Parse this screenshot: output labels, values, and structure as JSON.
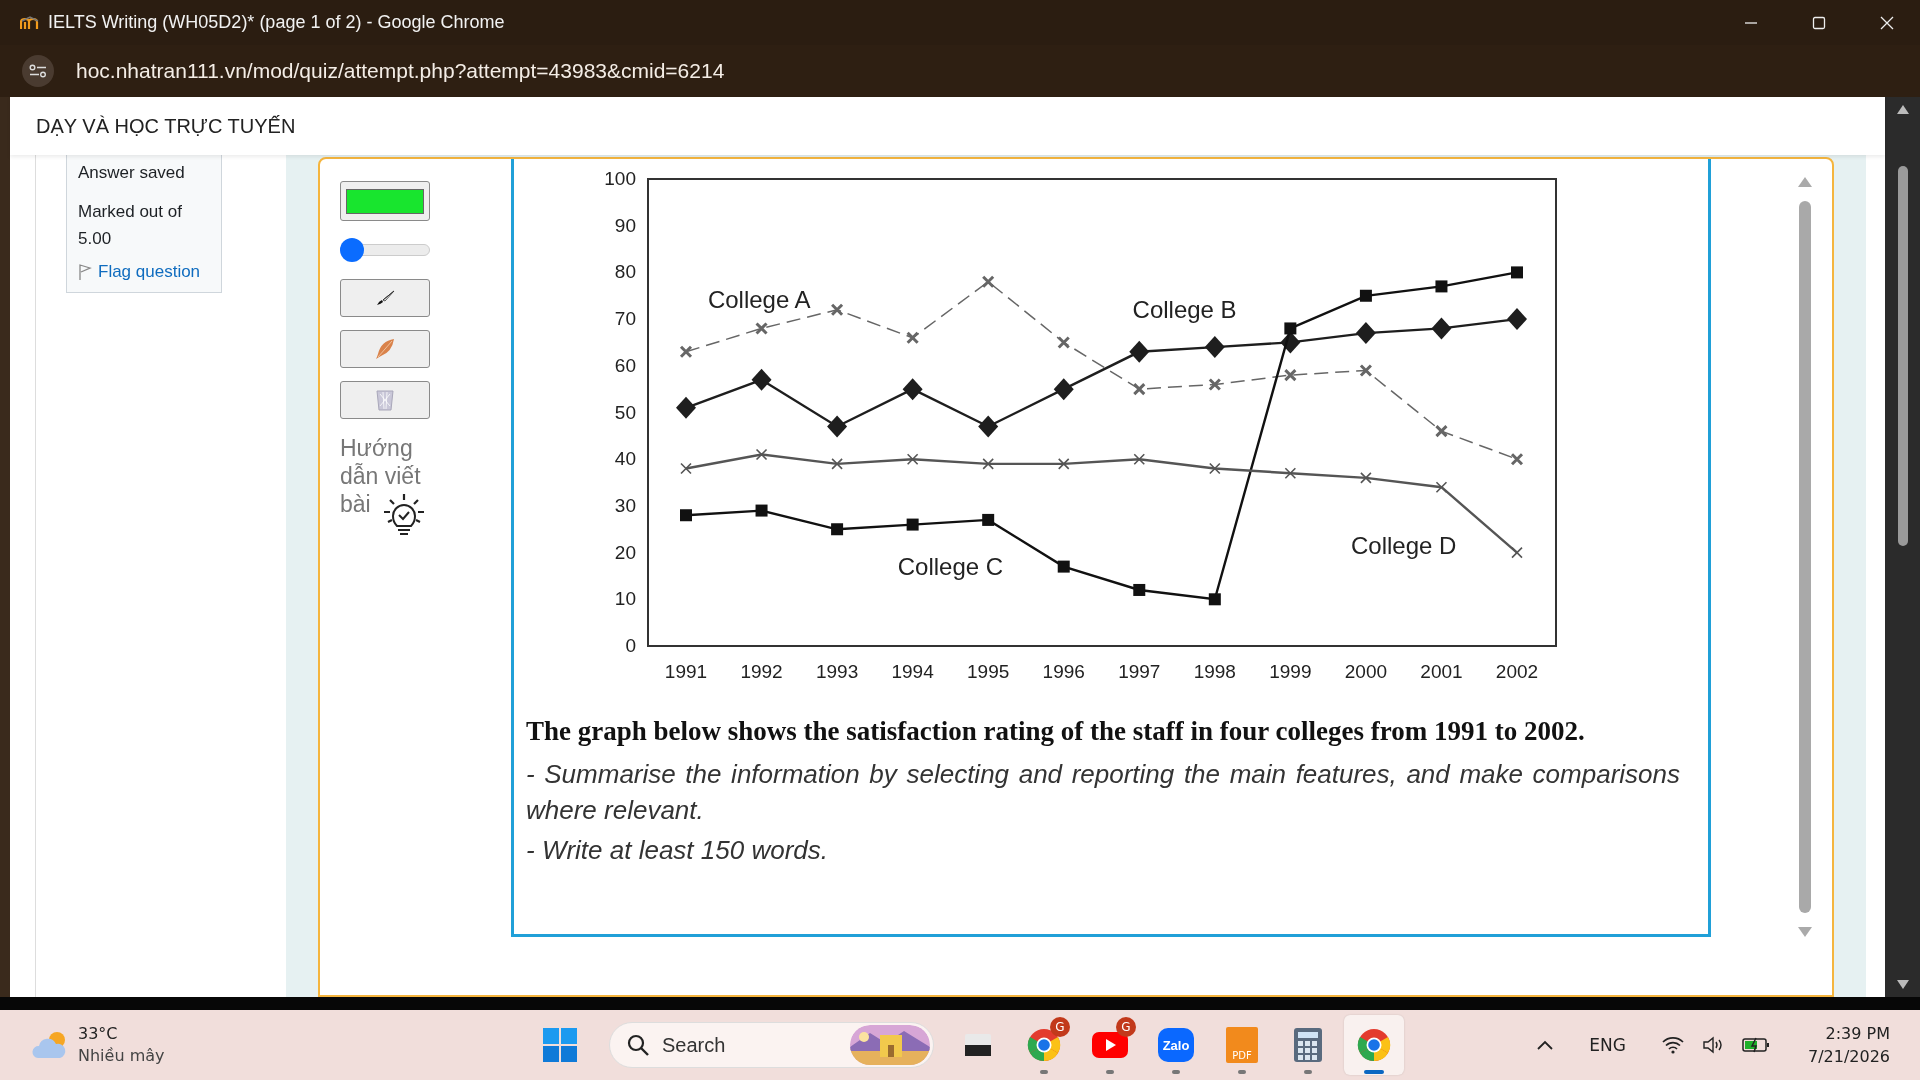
{
  "window": {
    "title": "IELTS Writing (WH05D2)* (page 1 of 2) - Google Chrome"
  },
  "address_bar": {
    "url": "hoc.nhatran111.vn/mod/quiz/attempt.php?attempt=43983&cmid=6214"
  },
  "site": {
    "title": "DẠY VÀ HỌC TRỰC TUYẾN"
  },
  "question_info": {
    "status": "Answer saved",
    "marks": "Marked out of 5.00",
    "flag_link": "Flag question"
  },
  "tools": {
    "color": "#18e52e",
    "size_slider": {
      "level": 0
    },
    "buttons": [
      {
        "kind": "brush"
      },
      {
        "kind": "feather"
      },
      {
        "kind": "trash"
      }
    ],
    "guide": "Hướng dẫn viết bài"
  },
  "question": {
    "chart_data": {
      "type": "line",
      "categories": [
        "1991",
        "1992",
        "1993",
        "1994",
        "1995",
        "1996",
        "1997",
        "1998",
        "1999",
        "2000",
        "2001",
        "2002"
      ],
      "ylim": [
        0,
        100
      ],
      "yticks": [
        0,
        10,
        20,
        30,
        40,
        50,
        60,
        70,
        80,
        90,
        100
      ],
      "series": [
        {
          "name": "College A",
          "color": "#666666",
          "marker": "cross",
          "line_style": "dashed",
          "values": [
            63,
            68,
            72,
            66,
            78,
            65,
            55,
            56,
            58,
            59,
            46,
            40
          ]
        },
        {
          "name": "College B",
          "color": "#1e1e1e",
          "marker": "diamond",
          "line_style": "solid",
          "values": [
            51,
            57,
            47,
            55,
            47,
            55,
            63,
            64,
            65,
            67,
            68,
            70
          ]
        },
        {
          "name": "College C",
          "color": "#111111",
          "marker": "square",
          "line_style": "solid",
          "values": [
            28,
            29,
            25,
            26,
            27,
            17,
            12,
            10,
            68,
            75,
            77,
            80
          ]
        },
        {
          "name": "College D",
          "color": "#555555",
          "marker": "cross",
          "line_style": "solid",
          "values": [
            38,
            41,
            39,
            40,
            39,
            39,
            40,
            38,
            37,
            36,
            34,
            20
          ]
        }
      ]
    },
    "prompt": "The graph below shows the satisfaction rating of the staff in four colleges from 1991 to 2002.",
    "instructions": [
      "- Summarise the information by selecting and reporting the main features, and make comparisons where relevant.",
      "- Write at least 150 words."
    ]
  },
  "taskbar": {
    "weather": {
      "temperature": "33°C",
      "condition": "Nhiều mây"
    },
    "search": {
      "placeholder": "Search"
    },
    "apps": [
      {
        "kind": "files",
        "running": false,
        "selected": false
      },
      {
        "kind": "chrome",
        "badge": "G",
        "running": true,
        "selected": false
      },
      {
        "kind": "youtube",
        "badge": "G",
        "running": true,
        "selected": false
      },
      {
        "kind": "zalo",
        "label": "Zalo",
        "running": true,
        "selected": false
      },
      {
        "kind": "pdf",
        "label": "PDF",
        "running": true,
        "selected": false
      },
      {
        "kind": "calculator",
        "running": true,
        "selected": false
      },
      {
        "kind": "chrome",
        "running": true,
        "selected": true
      }
    ],
    "language": "ENG",
    "time": "2:39 PM",
    "date": "7/21/2026"
  }
}
